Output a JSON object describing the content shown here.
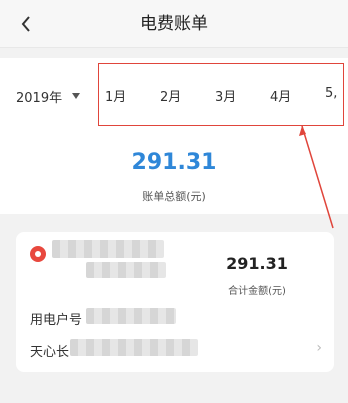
{
  "header": {
    "title": "电费账单"
  },
  "filter": {
    "year": "2019年",
    "months": [
      "1月",
      "2月",
      "3月",
      "4月",
      "5,"
    ]
  },
  "summary": {
    "total_value": "291.31",
    "total_label": "账单总额(元)"
  },
  "card": {
    "amount_value": "291.31",
    "amount_label": "合计金额(元)",
    "account_label": "用电户号",
    "name_prefix": "天心长"
  },
  "colors": {
    "accent": "#2f87d8",
    "highlight": "#e0453b",
    "logo": "#e8483e"
  }
}
